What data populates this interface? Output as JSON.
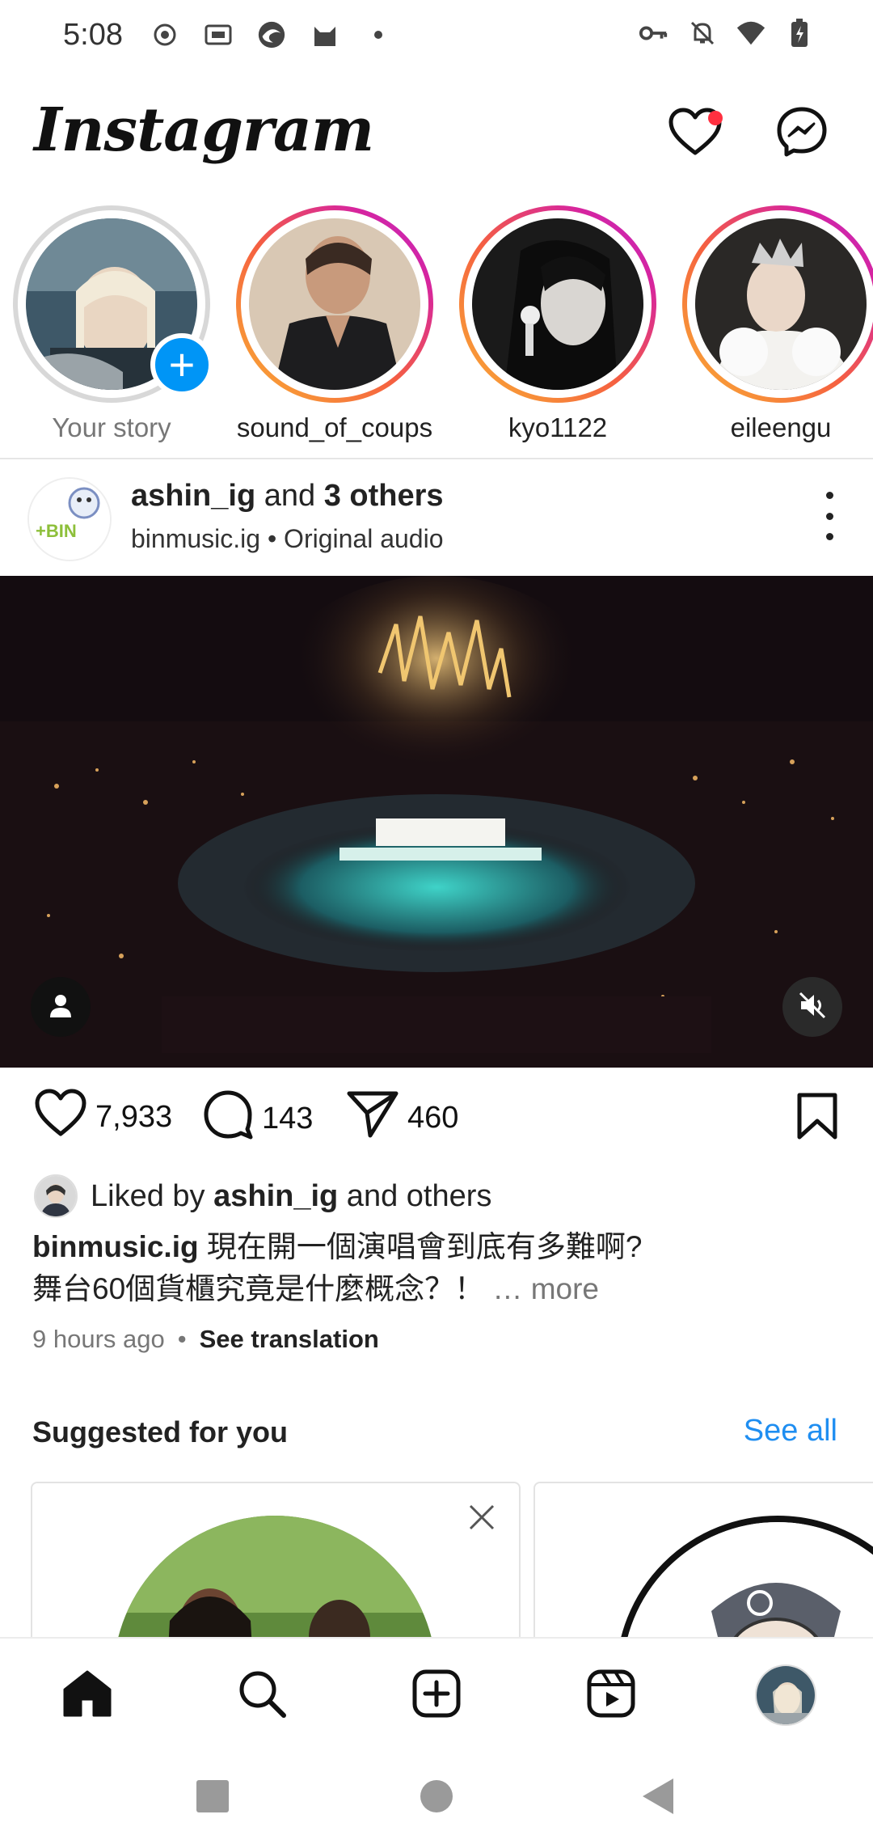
{
  "status_bar": {
    "time": "5:08"
  },
  "header": {
    "logo_text": "Instagram",
    "icons": [
      "heart-icon",
      "messenger-icon"
    ],
    "notification_dot": true
  },
  "stories": [
    {
      "label": "Your story",
      "own": true
    },
    {
      "label": "sound_of_coups",
      "own": false
    },
    {
      "label": "kyo1122",
      "own": false
    },
    {
      "label": "eileengu",
      "own": false
    }
  ],
  "post": {
    "user_main": "ashin_ig",
    "user_joiner": " and ",
    "user_others": "3 others",
    "subtitle": "binmusic.ig • Original audio",
    "avatar_text": "+BIN",
    "likes": "7,933",
    "comments": "143",
    "shares": "460",
    "liked_prefix": "Liked by ",
    "liked_user": "ashin_ig",
    "liked_suffix": " and others",
    "caption_user": "binmusic.ig",
    "caption_line1": " 現在開一個演唱會到底有多難啊?",
    "caption_line2": "舞台60個貨櫃究竟是什麼概念？！",
    "caption_more": " … more",
    "time_ago": "9 hours ago",
    "see_translation": "See translation"
  },
  "suggested": {
    "title": "Suggested for you",
    "see_all": "See all"
  },
  "colors": {
    "accent_blue": "#0095f6",
    "link_blue": "#1f8ef1",
    "notification_red": "#ff3040",
    "story_gradient": [
      "#f9b233",
      "#f56040",
      "#d6249f",
      "#b92ccf"
    ]
  }
}
